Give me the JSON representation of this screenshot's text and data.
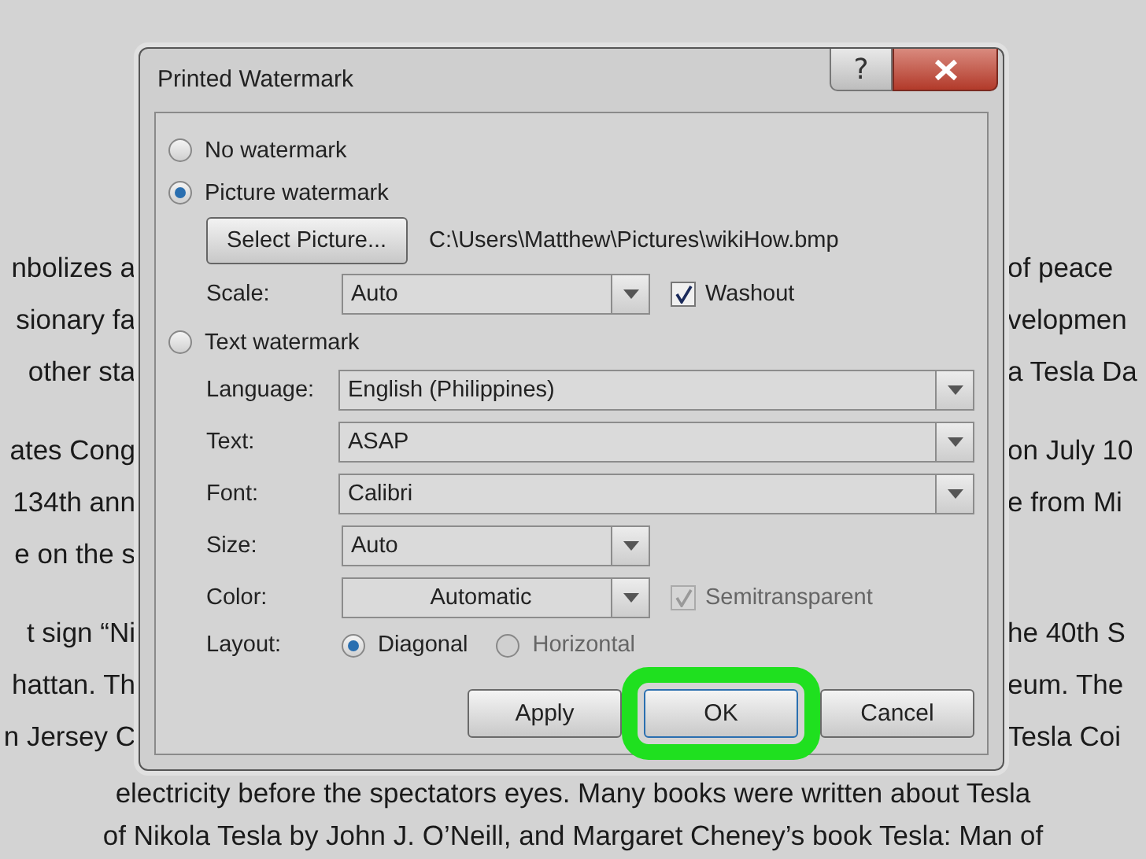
{
  "document": {
    "paragraphs": [
      {
        "lines": [
          {
            "left": "nbolizes a",
            "right": "of peace"
          },
          {
            "left": "sionary fa",
            "right": "velopmen"
          },
          {
            "left": "other sta",
            "right": "a Tesla Da"
          }
        ]
      },
      {
        "lines": [
          {
            "left": "ates Cong",
            "right": "on July 10"
          },
          {
            "left": "134th ann",
            "right": "e from Mi"
          },
          {
            "left": "e on the s"
          }
        ]
      },
      {
        "lines": [
          {
            "left": "t sign “Ni",
            "right": "he 40th S"
          },
          {
            "left": "hattan. Th",
            "right": "eum. The"
          },
          {
            "left": "n Jersey C",
            "right": "Tesla Coi"
          }
        ]
      }
    ],
    "full_lines": [
      "electricity before the spectators eyes. Many books were written about Tesla",
      "of Nikola Tesla by John J. O’Neill, and Margaret Cheney’s book Tesla: Man of"
    ]
  },
  "dialog": {
    "title": "Printed Watermark",
    "help": "?",
    "no_watermark": {
      "label": "No watermark",
      "selected": false
    },
    "picture_watermark": {
      "label": "Picture watermark",
      "selected": true,
      "select_button": "Select Picture...",
      "path": "C:\\Users\\Matthew\\Pictures\\wikiHow.bmp",
      "scale": {
        "label": "Scale:",
        "value": "Auto"
      },
      "washout": {
        "label": "Washout",
        "checked": true
      }
    },
    "text_watermark": {
      "label": "Text watermark",
      "selected": false,
      "fields": [
        {
          "label": "Language:",
          "value": "English (Philippines)",
          "kind": "wide"
        },
        {
          "label": "Text:",
          "value": "ASAP",
          "kind": "wide"
        },
        {
          "label": "Font:",
          "value": "Calibri",
          "kind": "wide"
        },
        {
          "label": "Size:",
          "value": "Auto",
          "kind": "narrow"
        },
        {
          "label": "Color:",
          "value": "Automatic",
          "kind": "color"
        }
      ],
      "semitransparent": {
        "label": "Semitransparent",
        "checked": true,
        "disabled": true
      },
      "layout": {
        "label": "Layout:",
        "options": [
          {
            "label": "Diagonal",
            "selected": true,
            "disabled": false
          },
          {
            "label": "Horizontal",
            "selected": false,
            "disabled": true
          }
        ]
      }
    },
    "buttons": [
      {
        "label": "Apply",
        "highlighted": false
      },
      {
        "label": "OK",
        "highlighted": true
      },
      {
        "label": "Cancel",
        "highlighted": false
      }
    ]
  }
}
